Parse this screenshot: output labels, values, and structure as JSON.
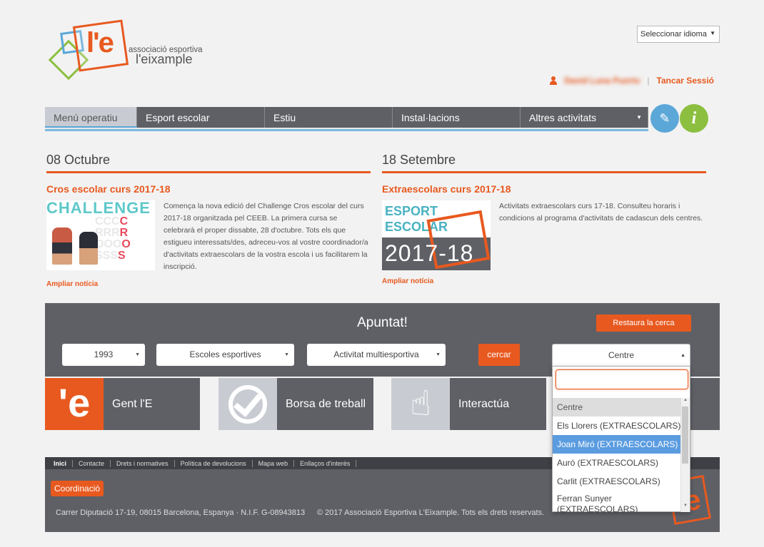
{
  "header": {
    "logo_line1": "associació esportiva",
    "logo_line2": "l'eixample",
    "logo_mark": "l'e",
    "language_select": "Seleccionar idioma",
    "user_name": "David Luna Puerto",
    "logout": "Tancar Sessió"
  },
  "nav": {
    "items": [
      "Menú operatiu",
      "Esport escolar",
      "Estiu",
      "Instal·lacions",
      "Altres activitats"
    ],
    "edit_icon": "pencil-icon",
    "info_icon": "info-icon",
    "info_glyph": "i"
  },
  "news": [
    {
      "date": "08 Octubre",
      "title": "Cros escolar curs 2017-18",
      "image_heading": "CHALLENGE",
      "text": "Comença la nova edició del Challenge Cros escolar del curs 2017-18 organitzada pel CEEB. La primera cursa se celebrarà el proper dissabte, 28 d'octubre. Tots els que estigueu interessats/des, adreceu-vos al vostre coordinador/a d'activitats extraescolars de la vostra escola i us facilitarem la inscripció.",
      "more": "Ampliar notícia"
    },
    {
      "date": "18 Setembre",
      "title": "Extraescolars curs 2017-18",
      "image_heading": "ESPORT ESCOLAR",
      "image_year": "2017-18",
      "text": "Activitats extraescolars curs 17-18. Consulteu horaris i condicions al programa d'activitats de cadascun dels centres.",
      "more": "Ampliar notícia"
    }
  ],
  "apuntat": {
    "title": "Apuntat!",
    "reset": "Restaura la cerca",
    "year": "1993",
    "school": "Escoles esportives",
    "activity": "Activitat multiesportiva",
    "search_button": "cercar",
    "centre": "Centre"
  },
  "tiles": [
    "Gent l'E",
    "Borsa de treball",
    "Interactúa"
  ],
  "dropdown": {
    "options": [
      "Centre",
      "Els Llorers (EXTRAESCOLARS)",
      "Joan Miró (EXTRAESCOLARS)",
      "Auró (EXTRAESCOLARS)",
      "Carlit (EXTRAESCOLARS)",
      "Ferran Sunyer (EXTRAESCOLARS)"
    ]
  },
  "footer": {
    "links": [
      "Inici",
      "Contacte",
      "Drets i normatives",
      "Política de devolucions",
      "Mapa web",
      "Enllaços d'interès"
    ],
    "coordinacio": "Coordinació",
    "address": "Carrer Diputació 17-19, 08015 Barcelona, Espanya · N.I.F. G-08943813",
    "copyright": "© 2017 Associació Esportiva L'Eixample. Tots els drets reservats.",
    "logo_mark": "'e"
  },
  "colors": {
    "accent": "#e8591f",
    "nav": "#5f6066",
    "blue": "#5ba7d8",
    "green": "#8cbf3f"
  }
}
